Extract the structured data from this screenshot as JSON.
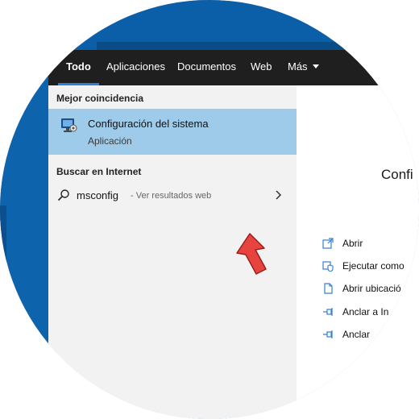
{
  "tabs": [
    {
      "label": "Todo",
      "active": true
    },
    {
      "label": "Aplicaciones",
      "active": false
    },
    {
      "label": "Documentos",
      "active": false
    },
    {
      "label": "Web",
      "active": false
    },
    {
      "label": "Más",
      "active": false
    }
  ],
  "best_match": {
    "section_title": "Mejor coincidencia",
    "name": "Configuración del sistema",
    "type": "Aplicación",
    "icon": "system-config-icon"
  },
  "internet": {
    "section_title": "Buscar en Internet",
    "query": "msconfig",
    "hint": "- Ver resultados web",
    "icon": "search-icon"
  },
  "detail": {
    "title_partial": "Confi",
    "actions": [
      {
        "label": "Abrir",
        "icon": "open-icon"
      },
      {
        "label": "Ejecutar como",
        "icon": "shield-icon"
      },
      {
        "label": "Abrir ubicació",
        "icon": "file-location-icon"
      },
      {
        "label": "Anclar a In",
        "icon": "pin-icon"
      },
      {
        "label": "Anclar",
        "icon": "pin-icon"
      }
    ]
  },
  "colors": {
    "accent": "#2f7fd6",
    "selection": "#9fcbea",
    "tabbar": "#1f1f1f",
    "desktop": "#0e63ad",
    "pointer_arrow": "#e8443f"
  }
}
